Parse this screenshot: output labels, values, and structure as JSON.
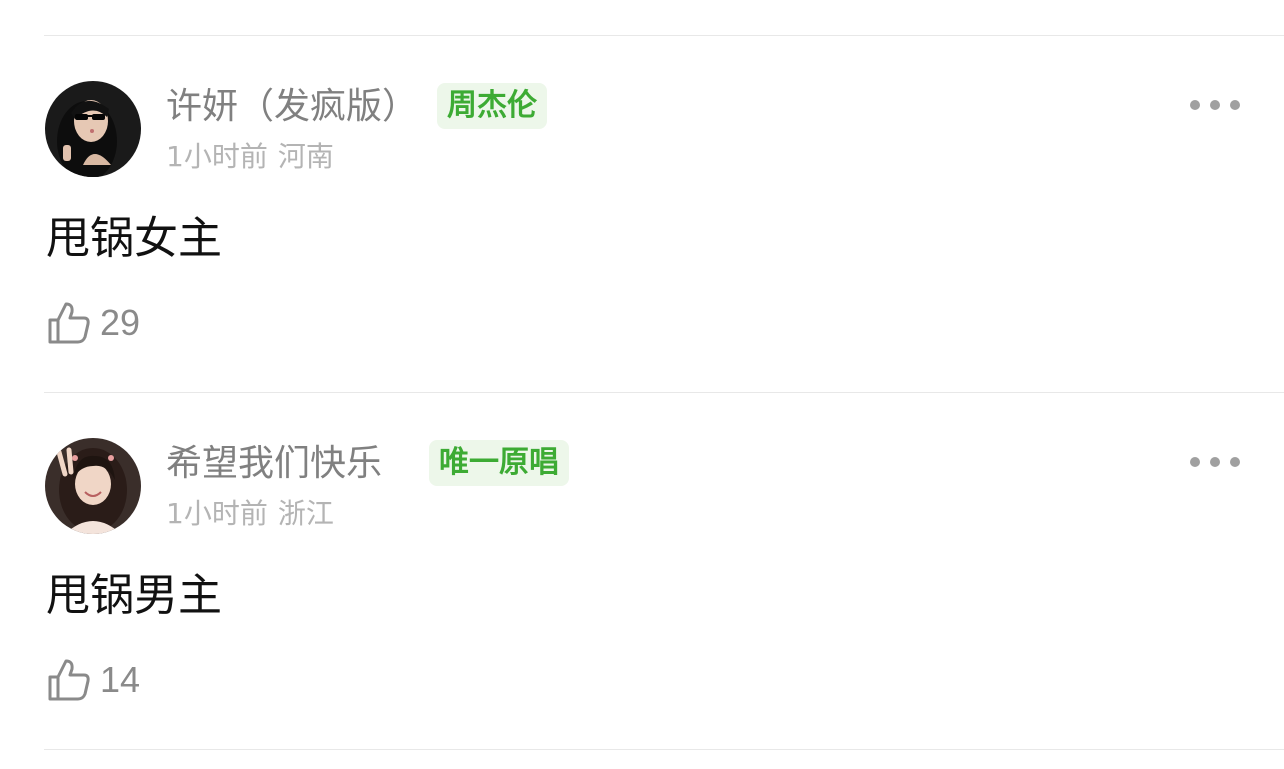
{
  "comments": [
    {
      "username": "许妍（发疯版）",
      "badge": "周杰伦",
      "time": "1小时前",
      "location": "河南",
      "text": "甩锅女主",
      "likes": "29",
      "avatar": "avatar-woman-sunglasses"
    },
    {
      "username": "希望我们快乐",
      "badge": "唯一原唱",
      "time": "1小时前",
      "location": "浙江",
      "text": "甩锅男主",
      "likes": "14",
      "avatar": "avatar-girl-peace-sign"
    }
  ],
  "icons": {
    "more": "more-dots-icon",
    "like": "thumbs-up-icon"
  },
  "colors": {
    "badge_text": "#3dab34",
    "badge_bg": "#edf7ea",
    "divider": "#e8e8e8",
    "username": "#808080",
    "meta": "#b4b4b4"
  }
}
